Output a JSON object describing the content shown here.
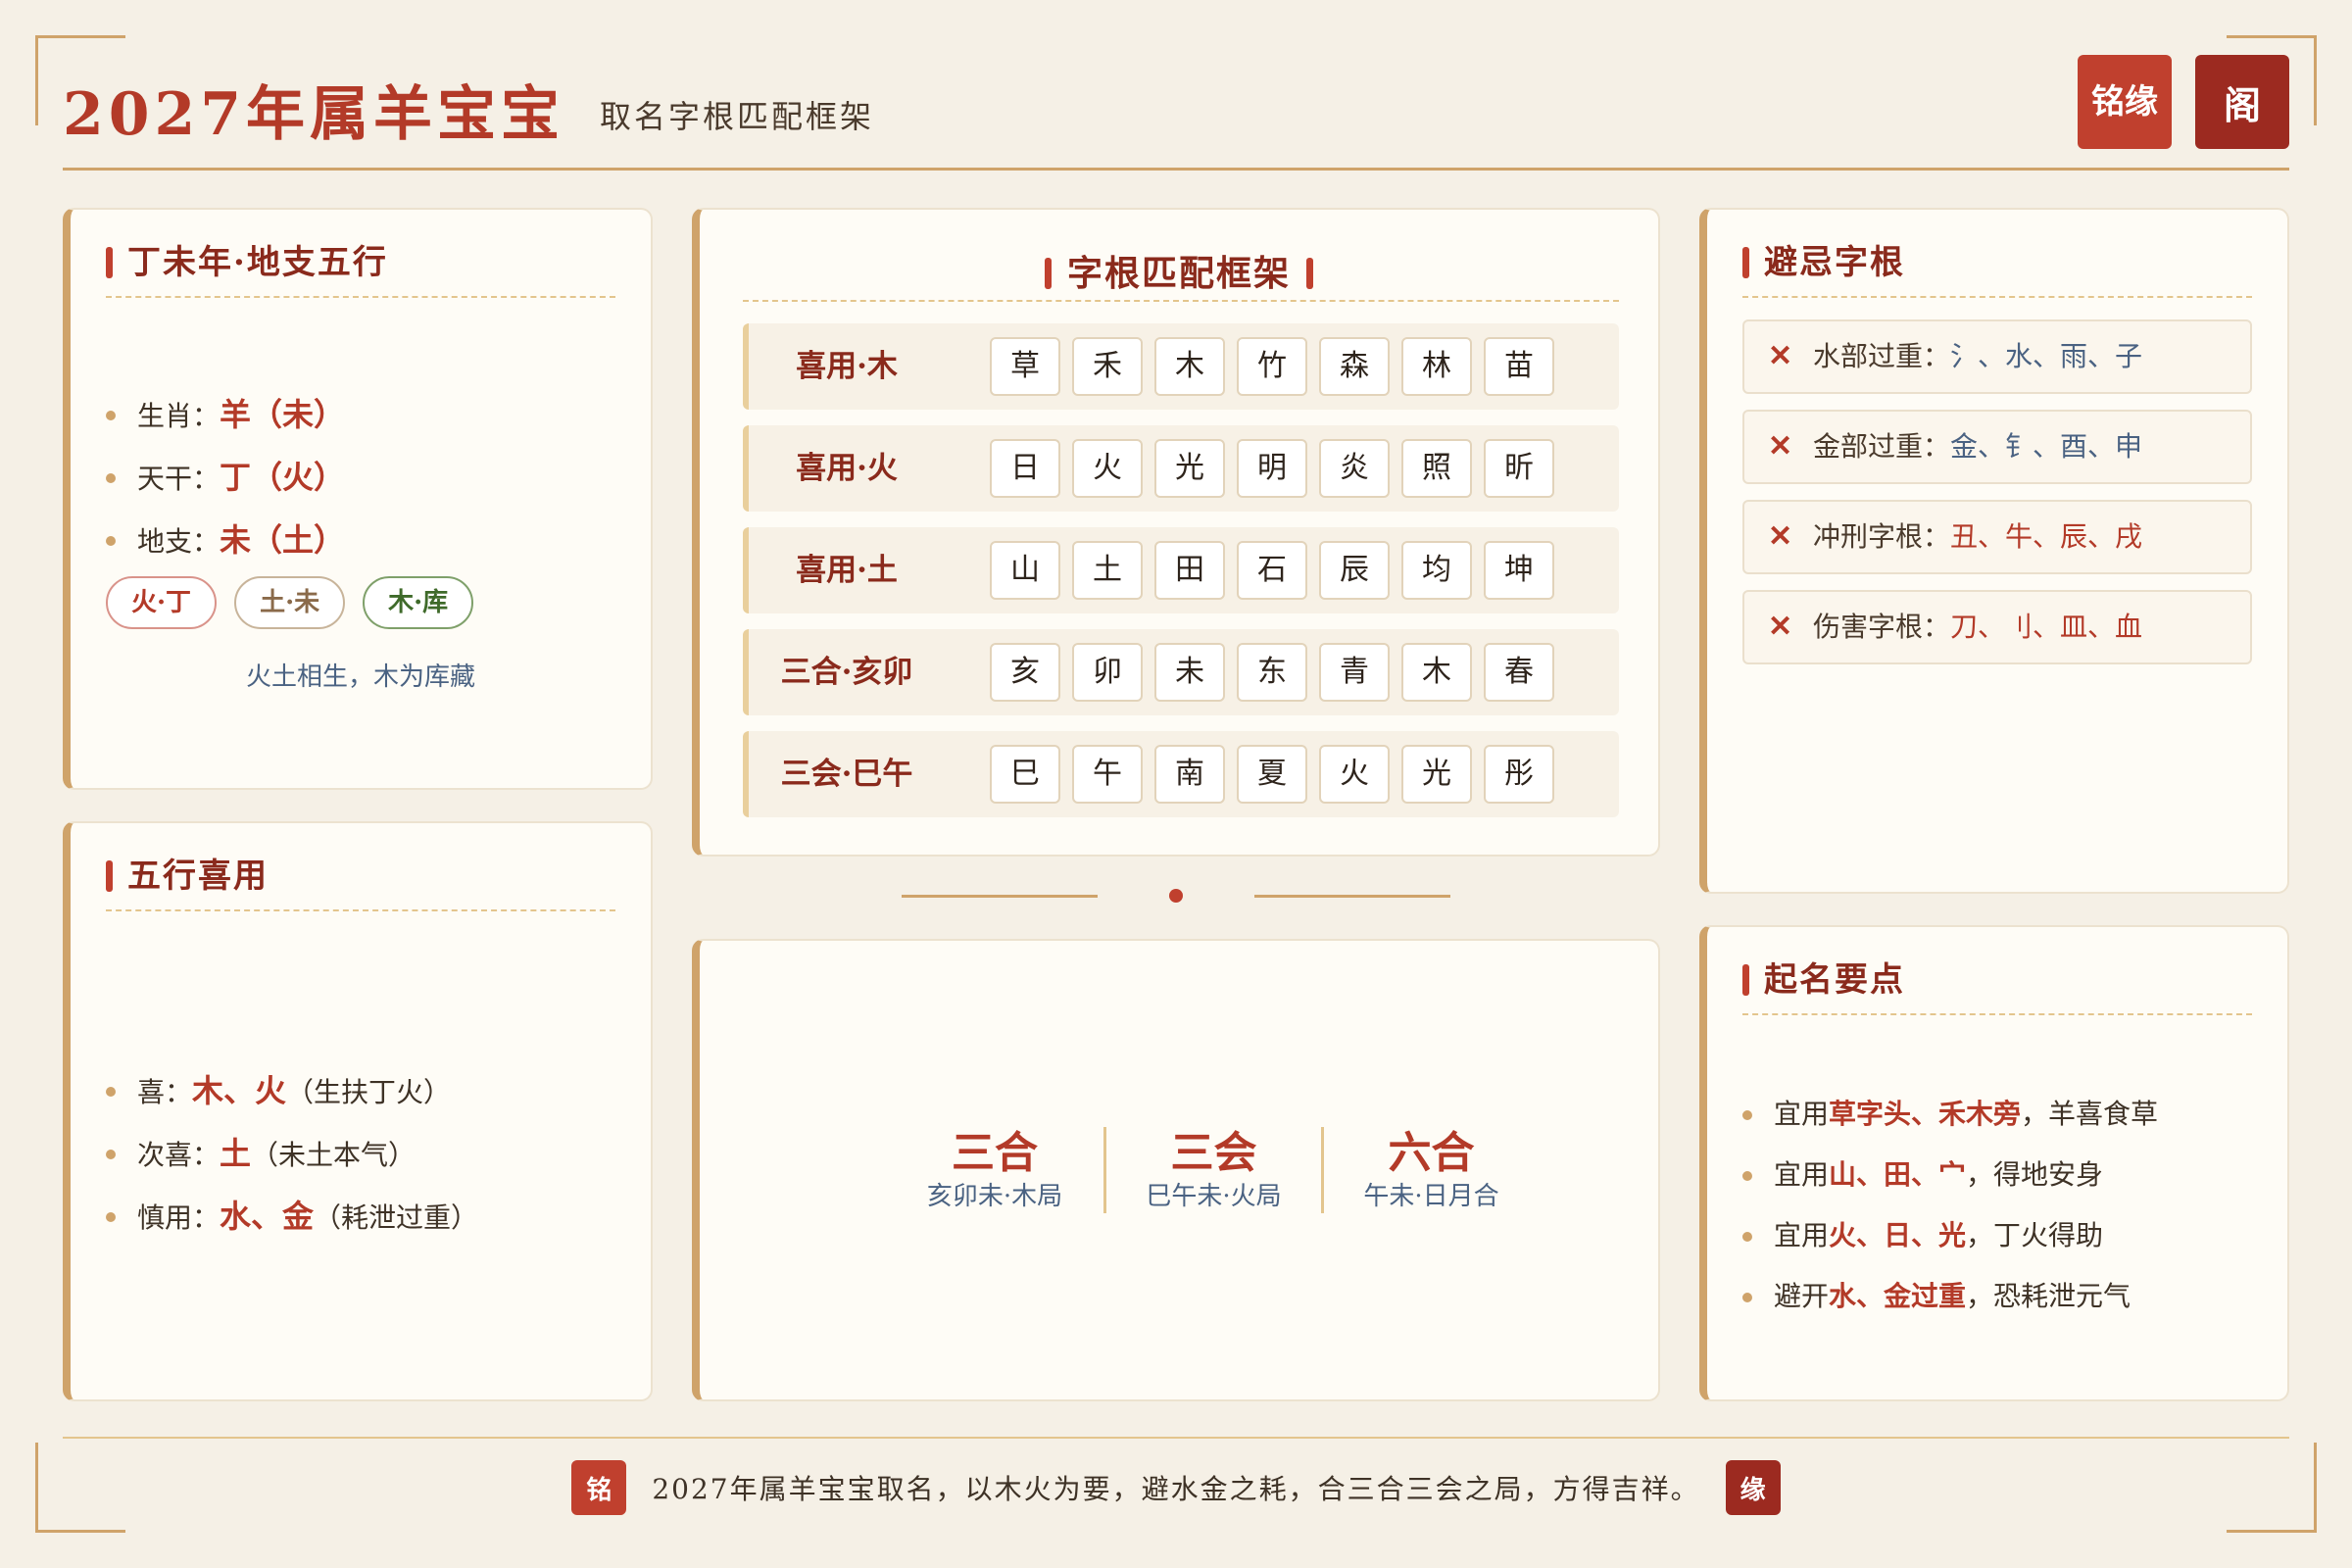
{
  "header": {
    "title": "2027年属羊宝宝",
    "subtitle": "取名字根匹配框架",
    "seal_a": "铭缘",
    "seal_b": "阁"
  },
  "zodiac": {
    "title": "丁未年·地支五行",
    "items": [
      {
        "label": "生肖：",
        "value": "羊（未）"
      },
      {
        "label": "天干：",
        "value": "丁（火）"
      },
      {
        "label": "地支：",
        "value": "未（土）"
      }
    ],
    "tags": [
      "火·丁",
      "土·未",
      "木·库"
    ],
    "note": "火土相生，木为库藏"
  },
  "wuxing": {
    "title": "五行喜用",
    "items": [
      {
        "label": "喜：",
        "value": "木、火",
        "extra": "（生扶丁火）"
      },
      {
        "label": "次喜：",
        "value": "土",
        "extra": "（未土本气）"
      },
      {
        "label": "慎用：",
        "value": "水、金",
        "extra": "（耗泄过重）"
      }
    ]
  },
  "framework": {
    "title": "字根匹配框架",
    "rows": [
      {
        "label": "喜用·木",
        "chars": [
          "草",
          "禾",
          "木",
          "竹",
          "森",
          "林",
          "苗"
        ]
      },
      {
        "label": "喜用·火",
        "chars": [
          "日",
          "火",
          "光",
          "明",
          "炎",
          "照",
          "昕"
        ]
      },
      {
        "label": "喜用·土",
        "chars": [
          "山",
          "土",
          "田",
          "石",
          "辰",
          "均",
          "坤"
        ]
      },
      {
        "label": "三合·亥卯",
        "chars": [
          "亥",
          "卯",
          "未",
          "东",
          "青",
          "木",
          "春"
        ]
      },
      {
        "label": "三会·巳午",
        "chars": [
          "巳",
          "午",
          "南",
          "夏",
          "火",
          "光",
          "彤"
        ]
      }
    ]
  },
  "combos": [
    {
      "title": "三合",
      "sub": "亥卯未·木局"
    },
    {
      "title": "三会",
      "sub": "巳午未·火局"
    },
    {
      "title": "六合",
      "sub": "午未·日月合"
    }
  ],
  "avoid": {
    "title": "避忌字根",
    "items": [
      {
        "label": "水部过重：",
        "value": "氵、水、雨、子"
      },
      {
        "label": "金部过重：",
        "value": "金、钅、酉、申"
      },
      {
        "label": "冲刑字根：",
        "value": "丑、牛、辰、戌"
      },
      {
        "label": "伤害字根：",
        "value": "刀、刂、皿、血"
      }
    ]
  },
  "tips": {
    "title": "起名要点",
    "items": [
      {
        "pre": "宜用",
        "hl": "草字头、禾木旁",
        "post": "，羊喜食草"
      },
      {
        "pre": "宜用",
        "hl": "山、田、宀",
        "post": "，得地安身"
      },
      {
        "pre": "宜用",
        "hl": "火、日、光",
        "post": "，丁火得助"
      },
      {
        "pre": "避开",
        "hl": "水、金过重",
        "post": "，恐耗泄元气"
      }
    ]
  },
  "footer": {
    "seal_a": "铭",
    "seal_b": "缘",
    "text": "2027年属羊宝宝取名，以木火为要，避水金之耗，合三合三会之局，方得吉祥。"
  },
  "colors": {
    "accent": "#b33a28",
    "gold": "#cfa36a",
    "blue": "#4a6282",
    "background": "#f5f0e6"
  }
}
